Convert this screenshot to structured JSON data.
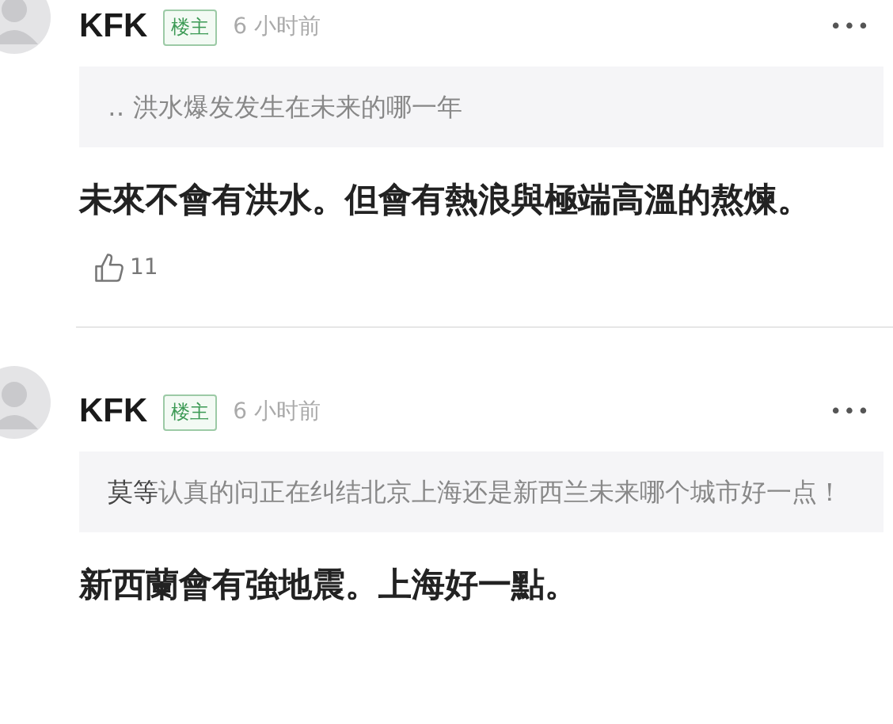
{
  "comments": [
    {
      "author": "KFK",
      "badge": "楼主",
      "time": "6 小时前",
      "more": "•••",
      "quote": {
        "text": "‥ 洪水爆发发生在未来的哪一年"
      },
      "body": "未來不會有洪水。但會有熱浪與極端高溫的熬煉。",
      "likes": "11"
    },
    {
      "author": "KFK",
      "badge": "楼主",
      "time": "6 小时前",
      "more": "•••",
      "quote": {
        "author": "莫等",
        "text": "认真的问正在纠结北京上海还是新西兰未来哪个城市好一点！"
      },
      "body": "新西蘭會有強地震。上海好一點。"
    }
  ]
}
